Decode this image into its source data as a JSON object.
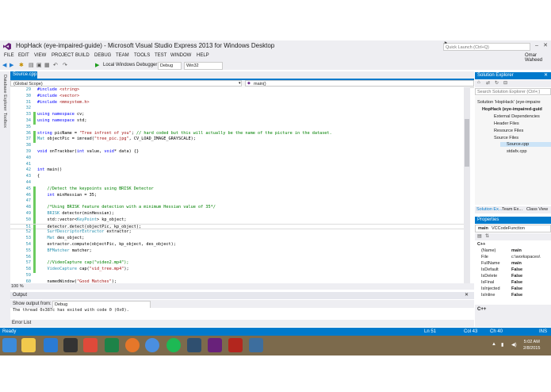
{
  "window": {
    "title": "HopHack (eye-impaired-guide) - Microsoft Visual Studio Express 2013 for Windows Desktop",
    "quick_launch_placeholder": "Quick Launch (Ctrl+Q)",
    "user": "Omar Waheed"
  },
  "menu": [
    "FILE",
    "EDIT",
    "VIEW",
    "PROJECT",
    "BUILD",
    "DEBUG",
    "TEAM",
    "TOOLS",
    "TEST",
    "WINDOW",
    "HELP"
  ],
  "toolbar": {
    "debugger": "Local Windows Debugger",
    "config": "Debug",
    "platform": "Win32"
  },
  "left_strip": [
    "Database Explorer",
    "Toolbox"
  ],
  "editor": {
    "tab": "Source.cpp",
    "scope": "(Global Scope)",
    "member": "main()",
    "zoom": "100 %",
    "lines": [
      {
        "n": "29",
        "t": "#include <string>"
      },
      {
        "n": "30",
        "t": "#include <vector>"
      },
      {
        "n": "31",
        "t": "#include <mmsystem.h>"
      },
      {
        "n": "32",
        "t": ""
      },
      {
        "n": "33",
        "t": "using namespace cv;"
      },
      {
        "n": "34",
        "t": "using namespace std;"
      },
      {
        "n": "35",
        "t": ""
      },
      {
        "n": "36",
        "t": "string picName = \"Tree infront of you\"; // hard coded but this will actually be the name of the picture in the dataset."
      },
      {
        "n": "37",
        "t": "Mat objectPic = imread(\"tree_pic.jpg\", CV_LOAD_IMAGE_GRAYSCALE);"
      },
      {
        "n": "38",
        "t": ""
      },
      {
        "n": "39",
        "t": "void onTrackbar(int value, void* data) {}"
      },
      {
        "n": "40",
        "t": ""
      },
      {
        "n": "41",
        "t": ""
      },
      {
        "n": "42",
        "t": "int main()"
      },
      {
        "n": "43",
        "t": "{"
      },
      {
        "n": "44",
        "t": ""
      },
      {
        "n": "45",
        "t": "    //Detect the keypoints using BRISK Detector"
      },
      {
        "n": "46",
        "t": "    int minHessian = 35;"
      },
      {
        "n": "47",
        "t": ""
      },
      {
        "n": "48",
        "t": "    /*Using BRISK feature detection with a minimum Hessian value of 35*/"
      },
      {
        "n": "49",
        "t": "    BRISK detector(minHessian);"
      },
      {
        "n": "50",
        "t": "    std::vector<KeyPoint> kp_object;"
      },
      {
        "n": "51",
        "t": "    detector.detect(objectPic, kp_object);"
      },
      {
        "n": "52",
        "t": "    SurfDescriptorExtractor extractor;"
      },
      {
        "n": "53",
        "t": "    Mat des_object;"
      },
      {
        "n": "54",
        "t": "    extractor.compute(objectPic, kp_object, des_object);"
      },
      {
        "n": "55",
        "t": "    BFMatcher matcher;"
      },
      {
        "n": "56",
        "t": ""
      },
      {
        "n": "57",
        "t": "    //VideoCapture cap(\"video2.mp4\");"
      },
      {
        "n": "58",
        "t": "    VideoCapture cap(\"vid_tree.mp4\");"
      },
      {
        "n": "59",
        "t": ""
      },
      {
        "n": "60",
        "t": "    namedWindow(\"Good Matches\");"
      }
    ]
  },
  "output": {
    "title": "Output",
    "show_from_label": "Show output from:",
    "source": "Debug",
    "text": "The thread 0x387c has exited with code 0 (0x0)."
  },
  "error_list_tab": "Error List",
  "solution_explorer": {
    "title": "Solution Explorer",
    "search_placeholder": "Search Solution Explorer (Ctrl+;)",
    "items": [
      "Solution 'HopHack' (eye-impaire",
      "HopHack (eye-impaired-guid",
      "External Dependencies",
      "Header Files",
      "Resource Files",
      "Source Files",
      "Source.cpp",
      "stdafx.cpp"
    ],
    "tabs": [
      "Solution Ex...",
      "Team Ex...",
      "Class View"
    ]
  },
  "properties": {
    "title": "Properties",
    "object": "main",
    "object_type": "VCCodeFunction",
    "section": "C++",
    "rows": [
      {
        "name": "(Name)",
        "value": "main"
      },
      {
        "name": "File",
        "value": "c:\\workspaces\\"
      },
      {
        "name": "FullName",
        "value": "main"
      },
      {
        "name": "IsDefault",
        "value": "False"
      },
      {
        "name": "IsDelete",
        "value": "False"
      },
      {
        "name": "IsFinal",
        "value": "False"
      },
      {
        "name": "IsInjected",
        "value": "False"
      },
      {
        "name": "IsInline",
        "value": "False"
      }
    ],
    "desc_title": "C++"
  },
  "status": {
    "state": "Ready",
    "ln": "Ln 51",
    "col": "Col 43",
    "ch": "Ch 40",
    "mode": "INS"
  },
  "taskbar": {
    "time": "5:02 AM",
    "date": "2/8/2015"
  },
  "colors": {
    "accent": "#007acc",
    "chrome": "#eeeef2",
    "comment": "#008000",
    "keyword": "#0000ff",
    "string": "#a31515",
    "type": "#2b91af",
    "taskbar": "#7c6a4c"
  }
}
